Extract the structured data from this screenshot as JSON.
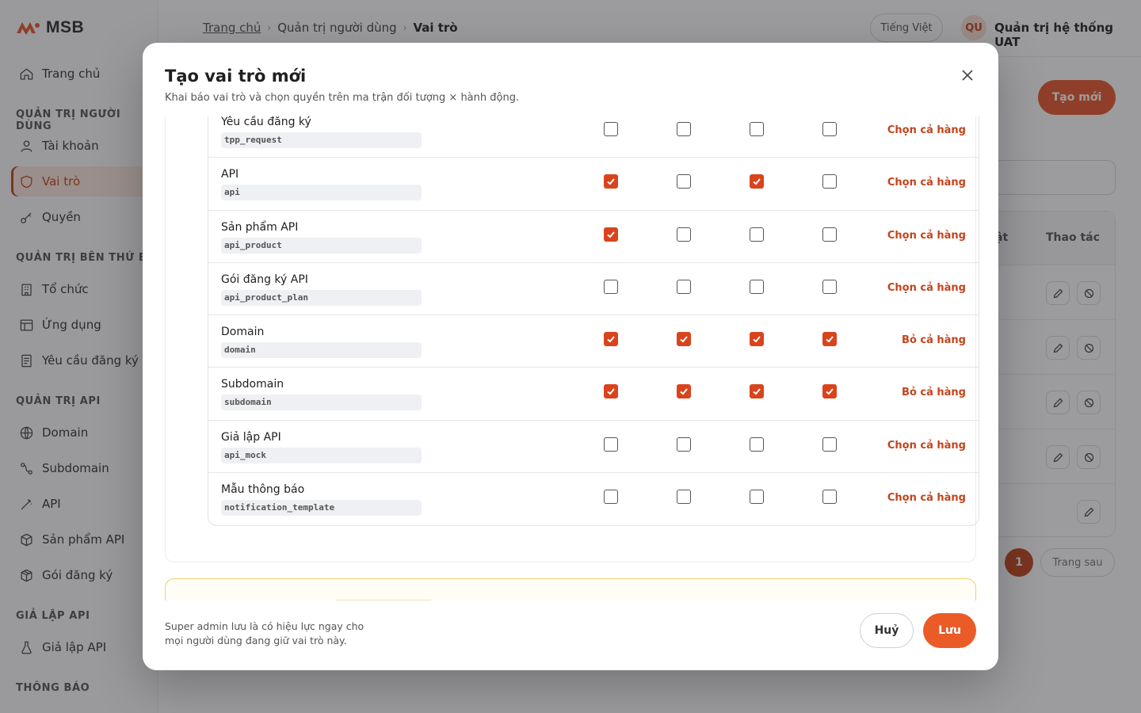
{
  "brand": {
    "logo_text": "MSB",
    "accent": "#c3441c",
    "primary": "#ea5b27"
  },
  "sidebar": {
    "items": [
      {
        "label": "Trang chủ",
        "icon": "home-icon"
      },
      {
        "label": "Tài khoản",
        "icon": "user-icon"
      },
      {
        "label": "Vai trò",
        "icon": "shield-icon",
        "active": true
      },
      {
        "label": "Quyền",
        "icon": "key-icon"
      },
      {
        "label": "Tổ chức",
        "icon": "building-icon"
      },
      {
        "label": "Ứng dụng",
        "icon": "app-window-icon"
      },
      {
        "label": "Yêu cầu đăng ký",
        "icon": "document-icon"
      },
      {
        "label": "Domain",
        "icon": "globe-icon"
      },
      {
        "label": "Subdomain",
        "icon": "route-icon"
      },
      {
        "label": "API",
        "icon": "wand-icon"
      },
      {
        "label": "Sản phẩm API",
        "icon": "box-icon"
      },
      {
        "label": "Gói đăng ký",
        "icon": "package-icon"
      },
      {
        "label": "Giả lập API",
        "icon": "flask-icon"
      }
    ],
    "sections": [
      "QUẢN TRỊ NGƯỜI DÙNG",
      "QUẢN TRỊ BÊN THỨ BA",
      "QUẢN TRỊ API",
      "GIẢ LẬP API",
      "THÔNG BÁO"
    ]
  },
  "header": {
    "breadcrumb": {
      "home": "Trang chủ",
      "parent": "Quản trị người dùng",
      "current": "Vai trò"
    },
    "language": "Tiếng Việt",
    "user_initials": "QU",
    "user_name": "Quản trị hệ thống UAT"
  },
  "page": {
    "create_button": "Tạo mới",
    "table_header_partial": "ật",
    "table_header_actions": "Thao tác",
    "pagination_current": "1",
    "pagination_next": "Trang sau"
  },
  "modal": {
    "title": "Tạo vai trò mới",
    "subtitle": "Khai báo vai trò và chọn quyền trên ma trận đối tượng × hành động.",
    "rows": [
      {
        "name": "Yêu cầu đăng ký",
        "code": "tpp_request",
        "checks": [
          false,
          false,
          false,
          false
        ],
        "action": "Chọn cả hàng"
      },
      {
        "name": "API",
        "code": "api",
        "checks": [
          true,
          false,
          true,
          false
        ],
        "action": "Chọn cả hàng"
      },
      {
        "name": "Sản phẩm API",
        "code": "api_product",
        "checks": [
          true,
          false,
          false,
          false
        ],
        "action": "Chọn cả hàng"
      },
      {
        "name": "Gói đăng ký API",
        "code": "api_product_plan",
        "checks": [
          false,
          false,
          false,
          false
        ],
        "action": "Chọn cả hàng"
      },
      {
        "name": "Domain",
        "code": "domain",
        "checks": [
          true,
          true,
          true,
          true
        ],
        "action": "Bỏ cả hàng"
      },
      {
        "name": "Subdomain",
        "code": "subdomain",
        "checks": [
          true,
          true,
          true,
          true
        ],
        "action": "Bỏ cả hàng"
      },
      {
        "name": "Giả lập API",
        "code": "api_mock",
        "checks": [
          false,
          false,
          false,
          false
        ],
        "action": "Chọn cả hàng"
      },
      {
        "name": "Mẫu thông báo",
        "code": "notification_template",
        "checks": [
          false,
          false,
          false,
          false
        ],
        "action": "Chọn cả hàng"
      }
    ],
    "footer_note": "Super admin lưu là có hiệu lực ngay cho mọi người dùng đang giữ vai trò này.",
    "cancel_label": "Huỷ",
    "save_label": "Lưu"
  }
}
